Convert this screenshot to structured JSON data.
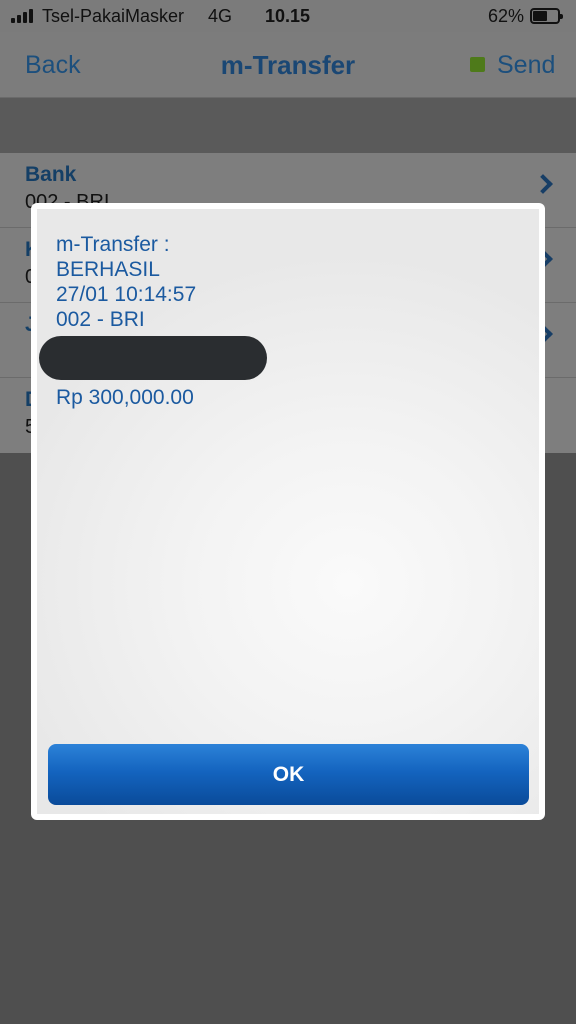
{
  "status_bar": {
    "carrier": "Tsel-PakaiMasker",
    "network": "4G",
    "time": "10.15",
    "battery_percent": "62%",
    "battery_level": 0.62
  },
  "nav": {
    "back_label": "Back",
    "title": "m-Transfer",
    "send_label": "Send",
    "send_indicator_color": "#4e7a1a"
  },
  "form": {
    "rows": [
      {
        "label": "Bank",
        "value": "002 - BRI"
      },
      {
        "label": "K",
        "value": "0"
      },
      {
        "label": "J",
        "value": ""
      },
      {
        "label": "D",
        "value": "5"
      }
    ]
  },
  "dialog": {
    "lines": [
      "m-Transfer :",
      "BERHASIL",
      "27/01 10:14:57",
      "002 - BRI"
    ],
    "amount": "Rp 300,000.00",
    "ok_label": "OK",
    "accent_color": "#1b5aa0"
  }
}
